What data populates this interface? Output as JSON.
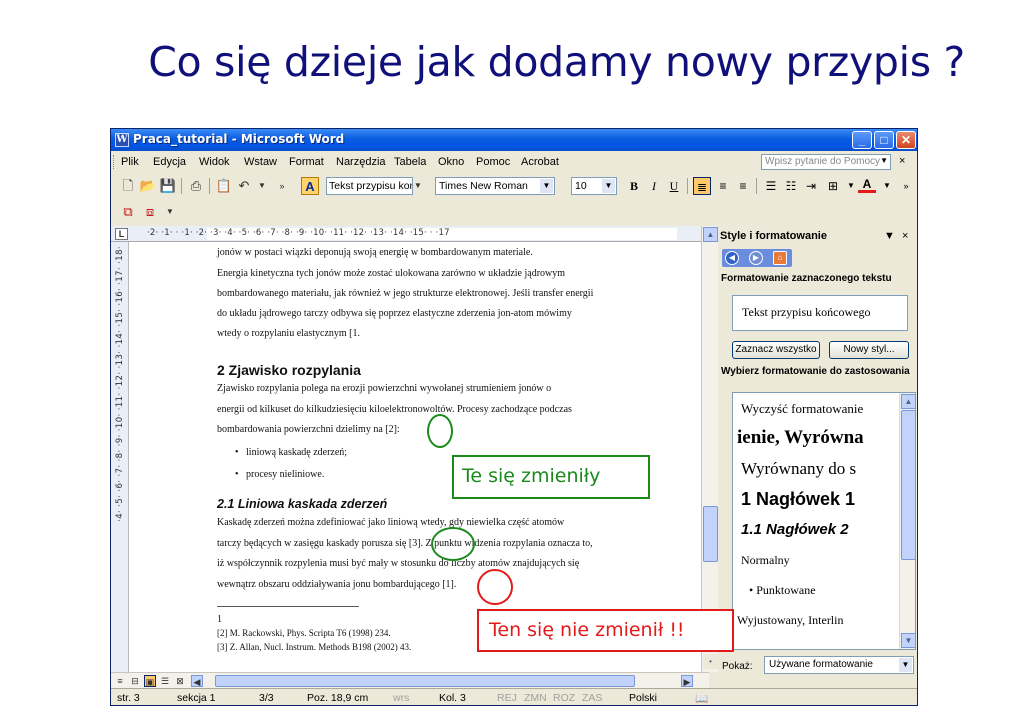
{
  "slide": {
    "title": "Co się dzieje jak dodamy nowy przypis ?"
  },
  "window": {
    "title": "Praca_tutorial - Microsoft Word",
    "app_icon": "W",
    "controls": {
      "minimize": "_",
      "maximize": "□",
      "close": "✕"
    }
  },
  "menu": {
    "items": [
      "Plik",
      "Edycja",
      "Widok",
      "Wstaw",
      "Format",
      "Narzędzia",
      "Tabela",
      "Okno",
      "Pomoc",
      "Acrobat"
    ],
    "help_placeholder": "Wpisz pytanie do Pomocy",
    "close": "×"
  },
  "toolbar": {
    "style": "Tekst przypisu końc",
    "font": "Times New Roman",
    "size": "10",
    "bold": "B",
    "italic": "I",
    "underline": "U",
    "font_color_label": "A"
  },
  "ruler": {
    "tab_selector": "L",
    "ticks": "·2· ·1· ·  ·1· ·2· ·3· ·4· ·5· ·6· ·7· ·8· ·9· ·10· ·11· ·12· ·13· ·14· ·15· ·  ·17",
    "vticks": "·4· ·5· ·6· ·7· ·8· ·9· ·10· ·11· ·12· ·13· ·14· ·15· ·16· ·17· ·18·"
  },
  "document": {
    "lines": [
      "jonów w postaci wiązki deponują swoją energię w bombardowanym materiale.",
      "        Energia kinetyczna tych jonów może zostać ulokowana zarówno w układzie jądrowym",
      "bombardowanego materiału, jak również w jego strukturze elektronowej. Jeśli transfer energii",
      "do układu jądrowego tarczy odbywa się poprzez elastyczne zderzenia jon-atom mówimy",
      "wtedy o rozpylaniu elastycznym [1."
    ],
    "heading2": "2  Zjawisko rozpylania",
    "para2": [
      "        Zjawisko rozpylania polega na erozji powierzchni wywołanej strumieniem jonów o",
      "energii od kilkuset do kilkudziesięciu kiloelektronowoltów. Procesy zachodzące podczas",
      "bombardowania powierzchni dzielimy na [2]:"
    ],
    "bullets": [
      "liniową kaskadę zderzeń;",
      "procesy nieliniowe."
    ],
    "heading3": "2.1  Liniowa kaskada zderzeń",
    "para3": [
      "        Kaskadę zderzeń można zdefiniować jako liniową wtedy, gdy niewielka część atomów",
      "tarczy będących w zasięgu kaskady porusza się [3]. Z punktu widzenia rozpylania oznacza to,",
      "iż współczynnik rozpylenia musi być mały w stosunku do liczby atomów znajdujących się",
      "wewnątrz obszaru oddziaływania jonu bombardującego [1]."
    ],
    "footnotes": [
      "1",
      "[2] M. Rackowski, Phys. Scripta T6 (1998) 234.",
      "[3] Z. Allan, Nucl. Instrum. Methods B198 (2002) 43."
    ]
  },
  "status": {
    "page": "str. 3",
    "section": "sekcja 1",
    "pages": "3/3",
    "pos": "Poz. 18,9 cm",
    "line": "wrs",
    "col": "Kol. 3",
    "rec": "REJ",
    "trk": "ZMN",
    "ext": "ROZ",
    "ovr": "ZAS",
    "lang": "Polski"
  },
  "taskpane": {
    "title": "Style i formatowanie",
    "selected_label": "Formatowanie zaznaczonego tekstu",
    "current_style": "Tekst przypisu końcowego",
    "select_all": "Zaznacz wszystko",
    "new_style": "Nowy styl...",
    "apply_label": "Wybierz formatowanie do zastosowania",
    "styles": [
      "Wyczyść formatowanie",
      "ienie, Wyrówna",
      "Wyrównany do s",
      "1  Nagłówek 1",
      "1.1  Nagłówek 2",
      "Normalny",
      "•  Punktowane",
      "Wyjustowany, Interlin"
    ],
    "show_label": "Pokaż:",
    "show_value": "Używane formatowanie"
  },
  "callouts": {
    "changed": "Te się zmieniły",
    "unchanged": "Ten się nie zmienił !!"
  },
  "colors": {
    "title": "#10107a",
    "green": "#1b8a1b",
    "red": "#e21a1a",
    "titlebar": "#0054e3"
  }
}
